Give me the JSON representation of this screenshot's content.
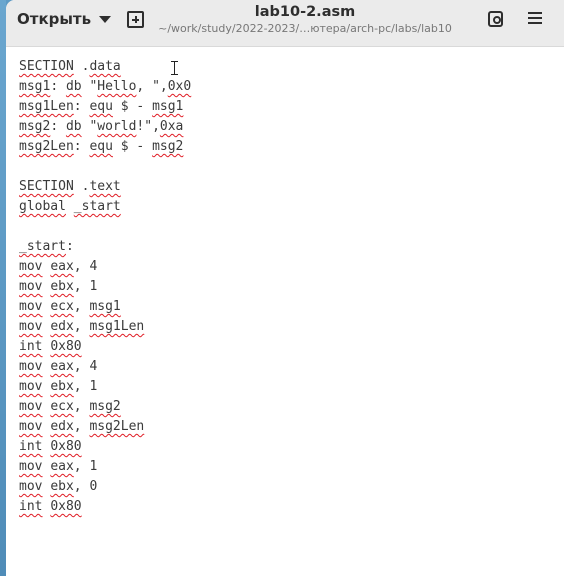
{
  "header": {
    "open_label": "Открыть",
    "file_name": "lab10-2.asm",
    "file_path": "~/work/study/2022-2023/…ютера/arch-pc/labs/lab10"
  },
  "editor": {
    "lines": [
      "SECTION .data",
      "msg1: db \"Hello, \",0x0",
      "msg1Len: equ $ - msg1",
      "msg2: db \"world!\",0xa",
      "msg2Len: equ $ - msg2",
      "",
      "SECTION .text",
      "global _start",
      "",
      "_start:",
      "mov eax, 4",
      "mov ebx, 1",
      "mov ecx, msg1",
      "mov edx, msg1Len",
      "int 0x80",
      "mov eax, 4",
      "mov ebx, 1",
      "mov ecx, msg2",
      "mov edx, msg2Len",
      "int 0x80",
      "mov eax, 1",
      "mov ebx, 0",
      "int 0x80"
    ]
  }
}
